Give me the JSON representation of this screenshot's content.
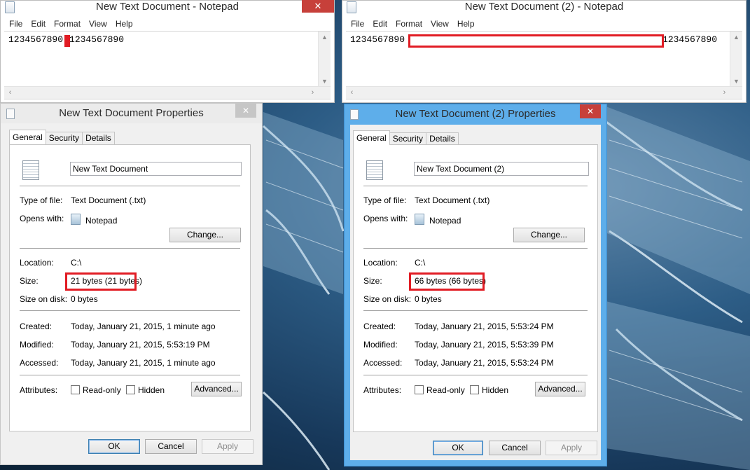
{
  "notepad1": {
    "title": "New Text Document - Notepad",
    "menu": [
      "File",
      "Edit",
      "Format",
      "View",
      "Help"
    ],
    "text_left": "1234567890",
    "text_right": "1234567890",
    "close_glyph": "✕"
  },
  "notepad2": {
    "title": "New Text Document (2) - Notepad",
    "menu": [
      "File",
      "Edit",
      "Format",
      "View",
      "Help"
    ],
    "text_left": "1234567890",
    "text_right": "1234567890"
  },
  "props1": {
    "title": "New Text Document Properties",
    "tabs": [
      "General",
      "Security",
      "Details"
    ],
    "filename": "New Text Document",
    "type_label": "Type of file:",
    "type_value": "Text Document (.txt)",
    "opens_label": "Opens with:",
    "opens_value": "Notepad",
    "change_button": "Change...",
    "location_label": "Location:",
    "location_value": "C:\\",
    "size_label": "Size:",
    "size_value": "21 bytes (21 bytes)",
    "sizedisk_label": "Size on disk:",
    "sizedisk_value": "0 bytes",
    "created_label": "Created:",
    "created_value": "Today, January 21, 2015, 1 minute ago",
    "modified_label": "Modified:",
    "modified_value": "Today, January 21, 2015, 5:53:19 PM",
    "accessed_label": "Accessed:",
    "accessed_value": "Today, January 21, 2015, 1 minute ago",
    "attributes_label": "Attributes:",
    "readonly_label": "Read-only",
    "hidden_label": "Hidden",
    "advanced_button": "Advanced...",
    "ok_button": "OK",
    "cancel_button": "Cancel",
    "apply_button": "Apply",
    "close_glyph": "✕"
  },
  "props2": {
    "title": "New Text Document (2) Properties",
    "tabs": [
      "General",
      "Security",
      "Details"
    ],
    "filename": "New Text Document (2)",
    "type_label": "Type of file:",
    "type_value": "Text Document (.txt)",
    "opens_label": "Opens with:",
    "opens_value": "Notepad",
    "change_button": "Change...",
    "location_label": "Location:",
    "location_value": "C:\\",
    "size_label": "Size:",
    "size_value": "66 bytes (66 bytes)",
    "sizedisk_label": "Size on disk:",
    "sizedisk_value": "0 bytes",
    "created_label": "Created:",
    "created_value": "Today, January 21, 2015, 5:53:24 PM",
    "modified_label": "Modified:",
    "modified_value": "Today, January 21, 2015, 5:53:39 PM",
    "accessed_label": "Accessed:",
    "accessed_value": "Today, January 21, 2015, 5:53:24 PM",
    "attributes_label": "Attributes:",
    "readonly_label": "Read-only",
    "hidden_label": "Hidden",
    "advanced_button": "Advanced...",
    "ok_button": "OK",
    "cancel_button": "Cancel",
    "apply_button": "Apply",
    "close_glyph": "✕"
  },
  "colors": {
    "highlight_red": "#e11c24",
    "active_frame": "#5eaeea",
    "close_red": "#c7403a"
  }
}
